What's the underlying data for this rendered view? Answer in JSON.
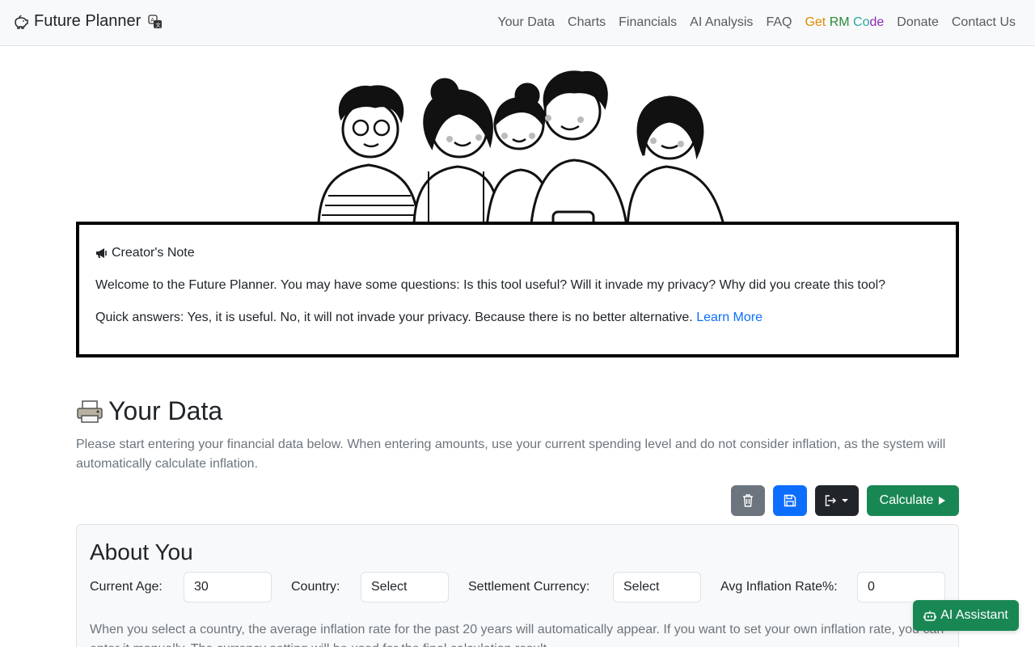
{
  "navbar": {
    "brand": "Future Planner",
    "links": [
      {
        "label": "Your Data"
      },
      {
        "label": "Charts"
      },
      {
        "label": "Financials"
      },
      {
        "label": "AI Analysis"
      },
      {
        "label": "FAQ"
      },
      {
        "label_parts": [
          "Get ",
          "RM ",
          "Co",
          "de"
        ]
      },
      {
        "label": "Donate"
      },
      {
        "label": "Contact Us"
      }
    ]
  },
  "note": {
    "title": "Creator's Note",
    "p1": "Welcome to the Future Planner. You may have some questions: Is this tool useful? Will it invade my privacy? Why did you create this tool?",
    "p2": "Quick answers: Yes, it is useful. No, it will not invade your privacy. Because there is no better alternative.",
    "learn_more": "Learn More"
  },
  "your_data": {
    "title": "Your Data",
    "description": "Please start entering your financial data below. When entering amounts, use your current spending level and do not consider inflation, as the system will automatically calculate inflation."
  },
  "toolbar": {
    "calculate_label": "Calculate",
    "icons": [
      "trash-icon",
      "save-icon",
      "export-icon",
      "play-icon"
    ]
  },
  "about": {
    "title": "About You",
    "age_label": "Current Age:",
    "age_value": "30",
    "country_label": "Country:",
    "country_value": "Select",
    "currency_label": "Settlement Currency:",
    "currency_value": "Select",
    "inflation_label": "Avg Inflation Rate%:",
    "inflation_value": "0",
    "hint": "When you select a country, the average inflation rate for the past 20 years will automatically appear. If you want to set your own inflation rate, you can enter it manually. The currency setting will be used for the final calculation result."
  },
  "ai_assistant": {
    "label": "AI Assistant"
  },
  "colors": {
    "primary": "#0d6efd",
    "success": "#198754",
    "secondary": "#6c757d",
    "dark": "#212529"
  }
}
